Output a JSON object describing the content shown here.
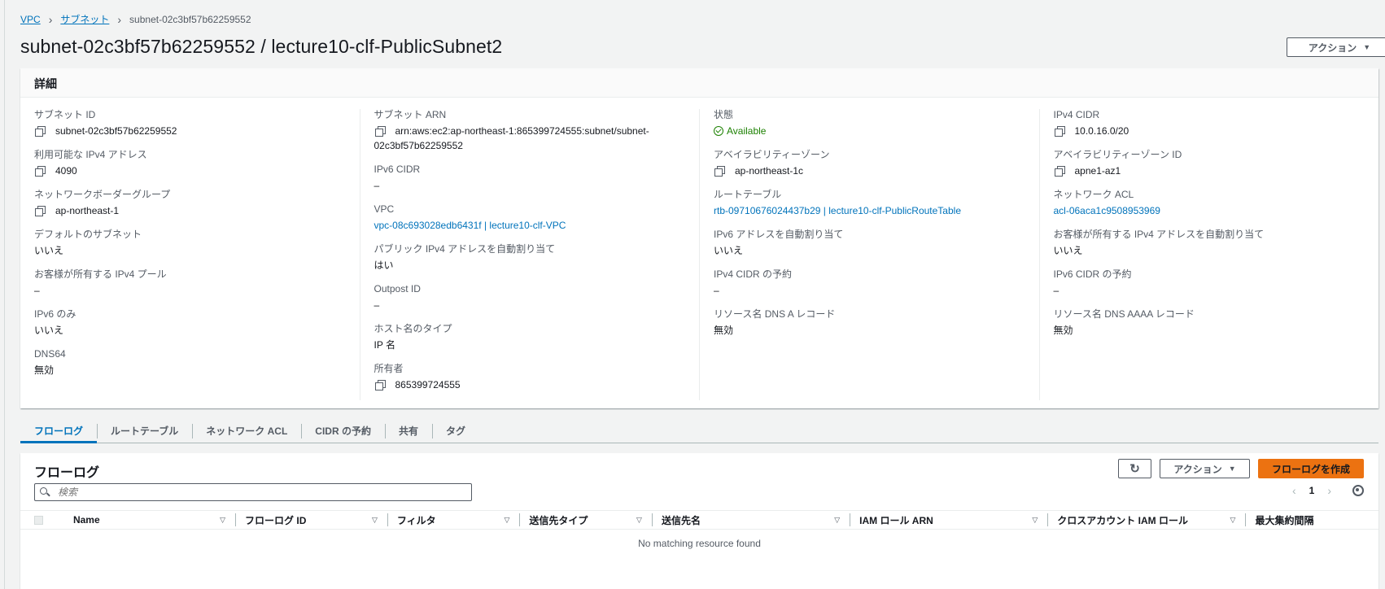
{
  "breadcrumb": {
    "root": "VPC",
    "parent": "サブネット",
    "current": "subnet-02c3bf57b62259552"
  },
  "page_title": "subnet-02c3bf57b62259552 / lecture10-clf-PublicSubnet2",
  "actions_label": "アクション",
  "details": {
    "header": "詳細",
    "col1": [
      {
        "label": "サブネット ID",
        "value": "subnet-02c3bf57b62259552"
      },
      {
        "label": "利用可能な IPv4 アドレス",
        "value": "4090"
      },
      {
        "label": "ネットワークボーダーグループ",
        "value": "ap-northeast-1"
      },
      {
        "label": "デフォルトのサブネット",
        "value": "いいえ"
      },
      {
        "label": "お客様が所有する IPv4 プール",
        "value": "–"
      },
      {
        "label": "IPv6 のみ",
        "value": "いいえ"
      },
      {
        "label": "DNS64",
        "value": "無効"
      }
    ],
    "col2": [
      {
        "label": "サブネット ARN",
        "value": "arn:aws:ec2:ap-northeast-1:865399724555:subnet/subnet-",
        "value2": "02c3bf57b62259552"
      },
      {
        "label": "IPv6 CIDR",
        "value": "–"
      },
      {
        "label": "VPC",
        "value": "vpc-08c693028edb6431f | lecture10-clf-VPC"
      },
      {
        "label": "パブリック IPv4 アドレスを自動割り当て",
        "value": "はい"
      },
      {
        "label": "Outpost ID",
        "value": "–"
      },
      {
        "label": "ホスト名のタイプ",
        "value": "IP 名"
      },
      {
        "label": "所有者",
        "value": "865399724555"
      }
    ],
    "col3": [
      {
        "label": "状態",
        "value": "Available"
      },
      {
        "label": "アベイラビリティーゾーン",
        "value": "ap-northeast-1c"
      },
      {
        "label": "ルートテーブル",
        "value": "rtb-09710676024437b29 | lecture10-clf-PublicRouteTable"
      },
      {
        "label": "IPv6 アドレスを自動割り当て",
        "value": "いいえ"
      },
      {
        "label": "IPv4 CIDR の予約",
        "value": "–"
      },
      {
        "label": "リソース名 DNS A レコード",
        "value": "無効"
      }
    ],
    "col4": [
      {
        "label": "IPv4 CIDR",
        "value": "10.0.16.0/20"
      },
      {
        "label": "アベイラビリティーゾーン ID",
        "value": "apne1-az1"
      },
      {
        "label": "ネットワーク ACL",
        "value": "acl-06aca1c9508953969"
      },
      {
        "label": "お客様が所有する IPv4 アドレスを自動割り当て",
        "value": "いいえ"
      },
      {
        "label": "IPv6 CIDR の予約",
        "value": "–"
      },
      {
        "label": "リソース名 DNS AAAA レコード",
        "value": "無効"
      }
    ]
  },
  "tabs": [
    "フローログ",
    "ルートテーブル",
    "ネットワーク ACL",
    "CIDR の予約",
    "共有",
    "タグ"
  ],
  "flow_logs": {
    "title": "フローログ",
    "actions_label": "アクション",
    "create_label": "フローログを作成",
    "search_placeholder": "検索",
    "page": "1",
    "columns": [
      "Name",
      "フローログ ID",
      "フィルタ",
      "送信先タイプ",
      "送信先名",
      "IAM ロール ARN",
      "クロスアカウント IAM ロール",
      "最大集約間隔"
    ],
    "empty_text": "No matching resource found"
  },
  "colors": {
    "link": "#0073bb",
    "primary": "#ec7211",
    "status_ok": "#1d8102"
  }
}
